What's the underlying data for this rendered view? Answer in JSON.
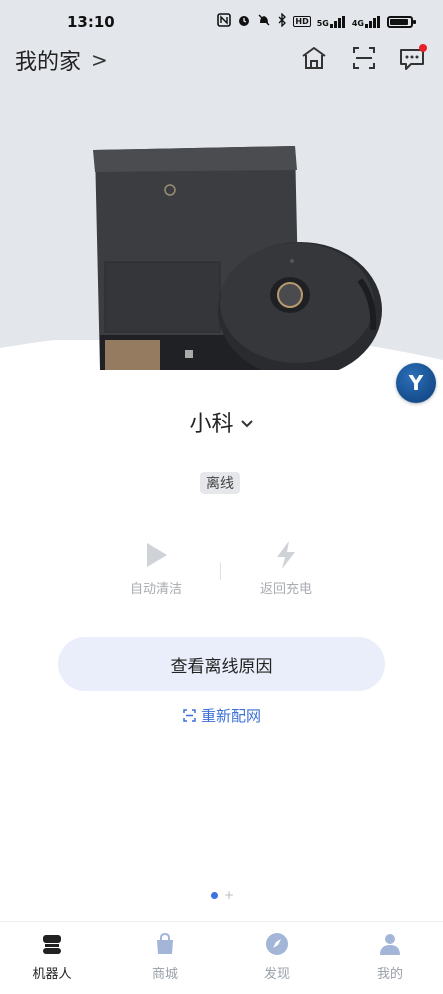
{
  "status_bar": {
    "time": "13:10",
    "network_1": "5G",
    "network_2": "4G",
    "hd": "HD"
  },
  "header": {
    "title": "我的家",
    "chevron": ">"
  },
  "device": {
    "name": "小科",
    "status": "离线"
  },
  "avatar": {
    "letter": "Y"
  },
  "actions": [
    {
      "label": "自动清洁",
      "icon": "play-icon"
    },
    {
      "label": "返回充电",
      "icon": "lightning-icon"
    }
  ],
  "primary_button": {
    "label": "查看离线原因"
  },
  "reconfigure": {
    "label": "重新配网"
  },
  "tabs": [
    {
      "label": "机器人",
      "icon": "robot-icon",
      "active": true
    },
    {
      "label": "商城",
      "icon": "shopping-bag-icon",
      "active": false
    },
    {
      "label": "发现",
      "icon": "compass-icon",
      "active": false
    },
    {
      "label": "我的",
      "icon": "person-icon",
      "active": false
    }
  ],
  "colors": {
    "accent": "#3b73e0",
    "button_bg": "#e9eefa",
    "hero_bg": "#e3e6eb",
    "notification": "#e8202a"
  }
}
